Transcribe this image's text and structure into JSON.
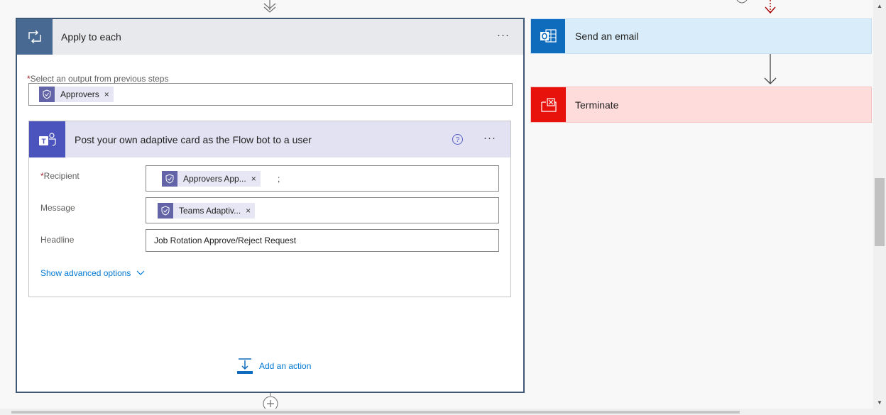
{
  "apply_to_each": {
    "title": "Apply to each",
    "menu_label": "···",
    "select_required_mark": "*",
    "select_label": "Select an output from previous steps",
    "select_token": {
      "label": "Approvers",
      "remove": "×"
    }
  },
  "teams_action": {
    "title": "Post your own adaptive card as the Flow bot to a user",
    "help_label": "?",
    "menu_label": "···",
    "fields": {
      "recipient": {
        "required_mark": "*",
        "label": "Recipient",
        "token_label": "Approvers App...",
        "token_remove": "×",
        "suffix": ";"
      },
      "message": {
        "label": "Message",
        "token_label": "Teams Adaptiv...",
        "token_remove": "×"
      },
      "headline": {
        "label": "Headline",
        "value": "Job Rotation Approve/Reject Request"
      }
    },
    "advanced_label": "Show advanced options"
  },
  "add_action_label": "Add an action",
  "right_branch": {
    "email_title": "Send an email",
    "terminate_title": "Terminate"
  },
  "icons": {
    "apply": "loop-icon",
    "dynamic_content": "dynamic-content-icon",
    "teams": "teams-icon",
    "outlook": "outlook-icon",
    "terminate": "terminate-icon",
    "add_action": "add-action-icon",
    "add_step": "plus-circle-icon"
  },
  "colors": {
    "apply_header": "#486991",
    "teams_accent": "#4b53bc",
    "token_accent": "#6264a7",
    "outlook_accent": "#0f6cbd",
    "terminate_accent": "#e8120c",
    "link": "#0078d4"
  }
}
